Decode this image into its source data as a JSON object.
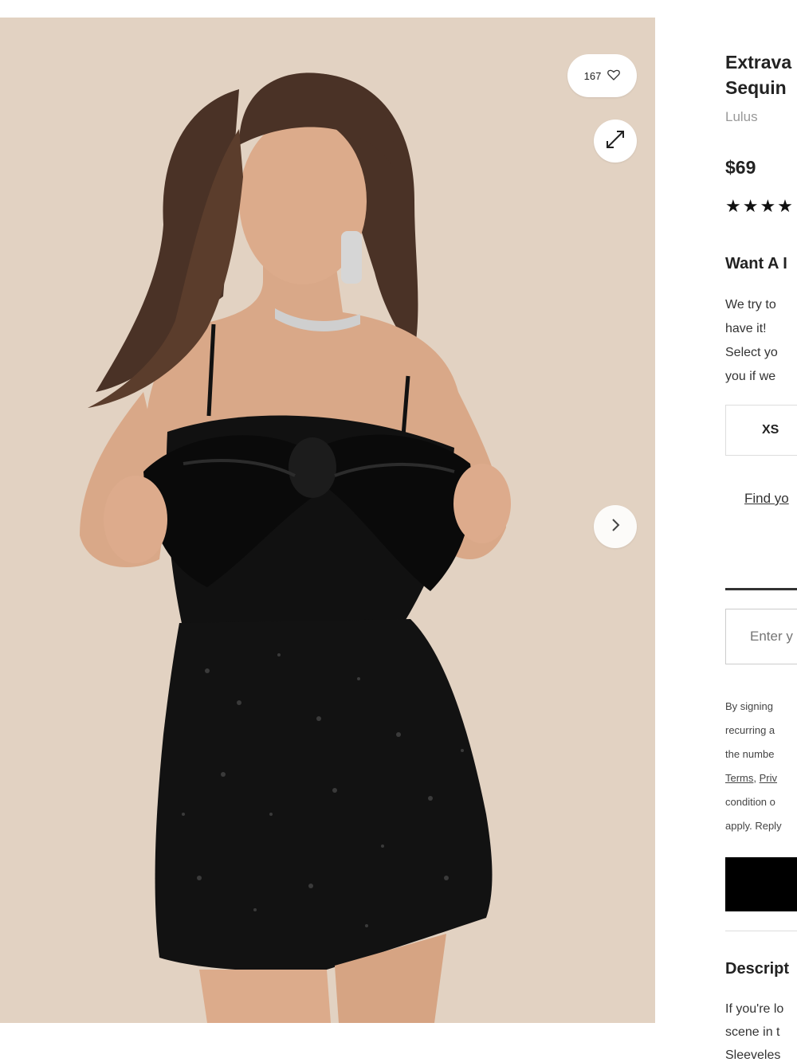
{
  "gallery": {
    "like_count": "167",
    "icons": {
      "like": "heart-icon",
      "expand": "expand-icon",
      "next": "chevron-right-icon"
    }
  },
  "product": {
    "title_line1": "Extrava",
    "title_line2": "Sequin",
    "brand": "Lulus",
    "price": "$69",
    "rating_stars": "★★★★",
    "want_heading": "Want A I",
    "notify_lines": [
      "We try to",
      "have it!",
      "Select yo",
      "you if we"
    ],
    "size_option": "XS",
    "find_link": "Find yo",
    "phone_placeholder": "Enter y",
    "legal_lines": [
      "By signing",
      "recurring a",
      "the numbe",
      "condition o",
      "apply. Reply"
    ],
    "legal_links": [
      "Terms",
      "Priv"
    ],
    "description_heading": "Descript",
    "description_lines": [
      "If you're lo",
      "scene in t",
      "Sleeveles"
    ]
  },
  "colors": {
    "background_image": "#e2d2c2",
    "button_black": "#000000",
    "brand_gray": "#999999"
  }
}
